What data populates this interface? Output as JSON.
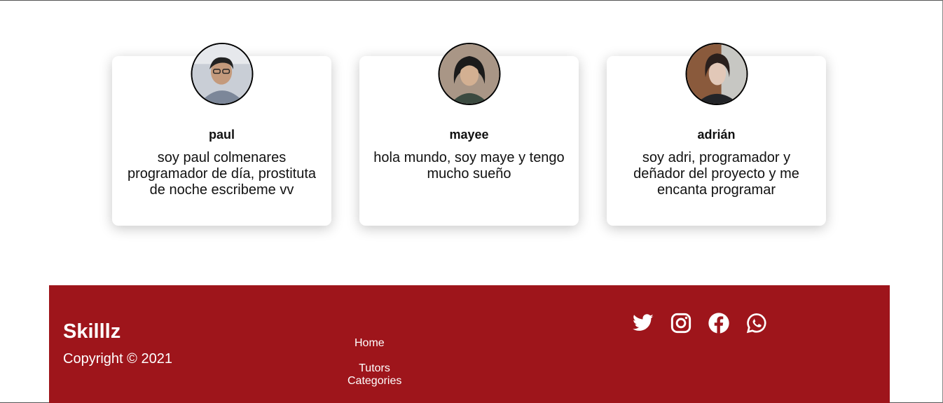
{
  "team": [
    {
      "name": "paul",
      "bio": "soy paul colmenares programador de día, prostituta de noche escribeme vv",
      "avatar_colors": {
        "bg": "#c9ced6",
        "skin": "#c49a7c",
        "hair": "#222222",
        "shirt": "#7c8799"
      }
    },
    {
      "name": "mayee",
      "bio": "hola mundo, soy maye y tengo mucho sueño",
      "avatar_colors": {
        "bg": "#a99686",
        "skin": "#d3b092",
        "hair": "#1b1b1b",
        "shirt": "#3b4a40"
      }
    },
    {
      "name": "adrián",
      "bio": "soy adri, programador y deñador del proyecto y me encanta programar",
      "avatar_colors": {
        "bg": "#8a5a3c",
        "skin": "#e2c8b8",
        "hair": "#2a1f1c",
        "shirt": "#222428"
      }
    }
  ],
  "footer": {
    "brand": "Skilllz",
    "copyright": "Copyright © 2021",
    "nav": {
      "home": "Home",
      "tutors_categories": "Tutors Categories"
    },
    "social_icons": [
      "twitter-icon",
      "instagram-icon",
      "facebook-icon",
      "whatsapp-icon"
    ],
    "background_color": "#9e151b"
  }
}
